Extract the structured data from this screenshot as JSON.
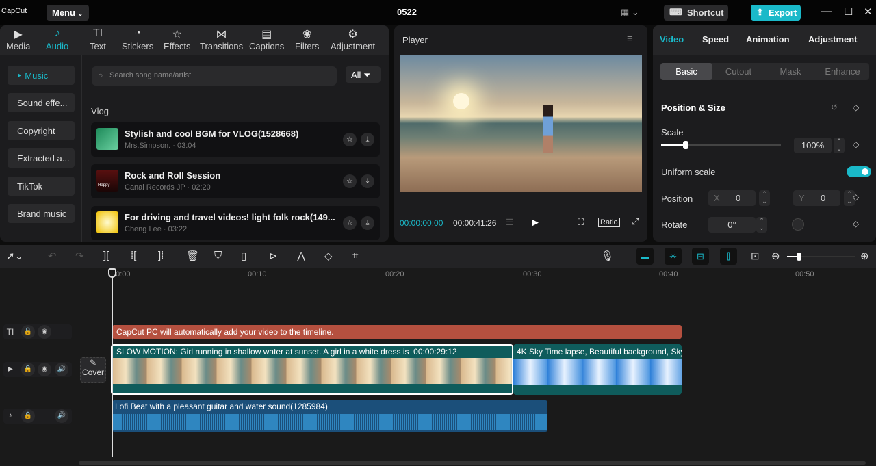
{
  "app": {
    "logo": "CapCut",
    "menu": "Menu",
    "project": "0522",
    "shortcut": "Shortcut",
    "export": "Export",
    "layout_icon": "layout-icon"
  },
  "tabs": [
    {
      "label": "Media",
      "icon": "▶"
    },
    {
      "label": "Audio",
      "icon": "♪"
    },
    {
      "label": "Text",
      "icon": "TI"
    },
    {
      "label": "Stickers",
      "icon": "◔"
    },
    {
      "label": "Effects",
      "icon": "☆"
    },
    {
      "label": "Transitions",
      "icon": "⋈"
    },
    {
      "label": "Captions",
      "icon": "▤"
    },
    {
      "label": "Filters",
      "icon": "❀"
    },
    {
      "label": "Adjustment",
      "icon": "⚙"
    }
  ],
  "sidebar": [
    "Music",
    "Sound effe...",
    "Copyright",
    "Extracted a...",
    "TikTok",
    "Brand music"
  ],
  "search": {
    "placeholder": "Search song name/artist"
  },
  "filter": "All",
  "section": "Vlog",
  "songs": [
    {
      "title": "Stylish and cool BGM for VLOG(1528668)",
      "meta": "Mrs.Simpson. · 03:04"
    },
    {
      "title": "Rock and Roll Session",
      "meta": "Canal Records JP · 02:20",
      "thumb_text": "Happy"
    },
    {
      "title": "For driving and travel videos! light folk rock(149...",
      "meta": "Cheng Lee · 03:22"
    }
  ],
  "player": {
    "title": "Player",
    "current": "00:00:00:00",
    "duration": "00:00:41:26",
    "ratio": "Ratio"
  },
  "right": {
    "tabs": [
      "Video",
      "Speed",
      "Animation",
      "Adjustment"
    ],
    "subtabs": [
      "Basic",
      "Cutout",
      "Mask",
      "Enhance"
    ],
    "section": "Position & Size",
    "scale_label": "Scale",
    "scale": "100%",
    "scale_value": 100,
    "uniform": "Uniform scale",
    "uniform_on": true,
    "position_label": "Position",
    "x_label": "X",
    "x": "0",
    "y_label": "Y",
    "y": "0",
    "rotate_label": "Rotate",
    "rotate": "0°"
  },
  "ruler": [
    "00:00",
    "00:10",
    "00:20",
    "00:30",
    "00:40",
    "00:50"
  ],
  "cover": "Cover",
  "clips": {
    "text": "CapCut PC will automatically add your video to the timeline.",
    "video1": "SLOW MOTION: Girl running in shallow water at sunset. A girl in a white dress is",
    "video1_dur": "00:00:29:12",
    "video2": "4K Sky Time lapse, Beautiful background, Sky",
    "audio": "Lofi Beat with a pleasant guitar and water sound(1285984)"
  },
  "colors": {
    "accent": "#1ab9c9",
    "text_clip": "#b5503f",
    "video_clip": "#0f5c5c",
    "audio_clip": "#1b4f7a"
  }
}
